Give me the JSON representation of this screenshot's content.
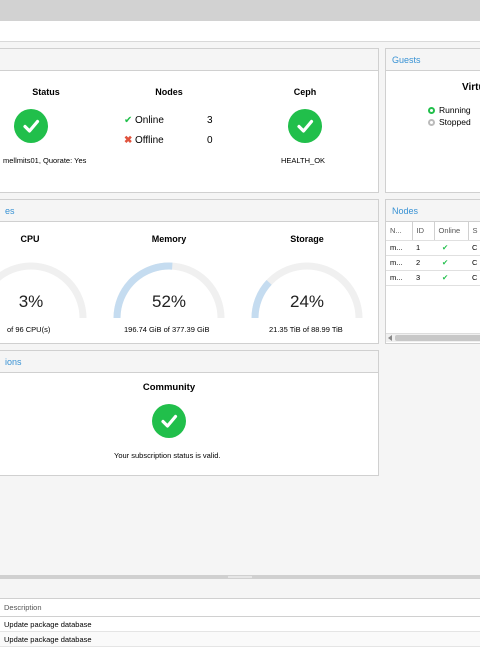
{
  "cluster_panel": {
    "status": {
      "title": "Status",
      "info": "mellmits01, Quorate: Yes"
    },
    "nodes": {
      "title": "Nodes",
      "rows": [
        {
          "label": "Online",
          "count": "3"
        },
        {
          "label": "Offline",
          "count": "0"
        }
      ]
    },
    "ceph": {
      "title": "Ceph",
      "status_text": "HEALTH_OK"
    }
  },
  "guests_panel": {
    "title": "Guests",
    "subtitle": "Virtu",
    "legend": [
      {
        "label": "Running"
      },
      {
        "label": "Stopped"
      }
    ]
  },
  "resources_panel": {
    "title_fragment": "es",
    "cpu": {
      "title": "CPU",
      "percent": "3%",
      "value": 0.03,
      "detail": "of 96 CPU(s)"
    },
    "memory": {
      "title": "Memory",
      "percent": "52%",
      "value": 0.52,
      "detail": "196.74 GiB of 377.39 GiB"
    },
    "storage": {
      "title": "Storage",
      "percent": "24%",
      "value": 0.24,
      "detail": "21.35 TiB of 88.99 TiB"
    }
  },
  "nodes_panel": {
    "title": "Nodes",
    "columns": [
      "N...",
      "ID",
      "Online",
      "S"
    ],
    "rows": [
      {
        "name": "m...",
        "id": "1",
        "extra": "C"
      },
      {
        "name": "m...",
        "id": "2",
        "extra": "C"
      },
      {
        "name": "m...",
        "id": "3",
        "extra": "C"
      }
    ]
  },
  "subscriptions_panel": {
    "title_fragment": "ions",
    "level": "Community",
    "message": "Your subscription status is valid."
  },
  "tasks": {
    "column_description": "Description",
    "rows": [
      {
        "description": "Update package database"
      },
      {
        "description": "Update package database"
      }
    ]
  },
  "colors": {
    "accent": "#3892d4",
    "ok": "#21bf4b",
    "error": "#e0533d",
    "gauge_track": "#f0f0f0",
    "gauge_fill": "#c5dcf0"
  }
}
